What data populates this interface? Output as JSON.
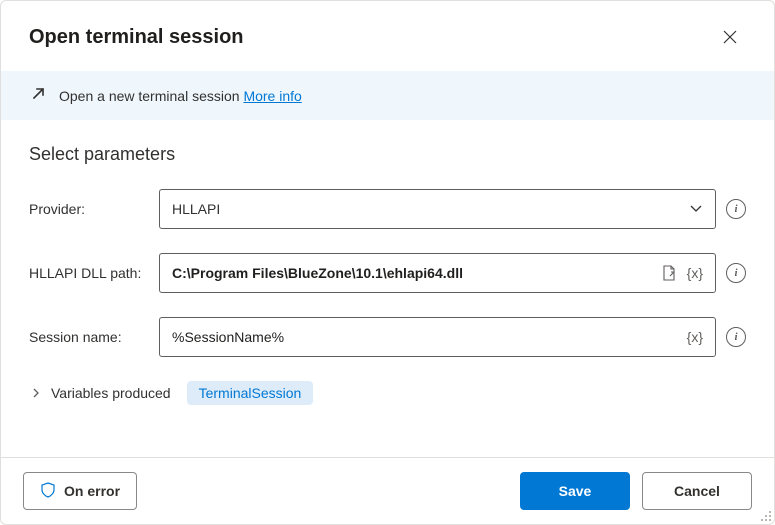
{
  "dialog": {
    "title": "Open terminal session"
  },
  "banner": {
    "text": "Open a new terminal session ",
    "link": "More info"
  },
  "section": {
    "heading": "Select parameters"
  },
  "form": {
    "provider": {
      "label": "Provider:",
      "value": "HLLAPI"
    },
    "dllpath": {
      "label": "HLLAPI DLL path:",
      "value": "C:\\Program Files\\BlueZone\\10.1\\ehlapi64.dll"
    },
    "session": {
      "label": "Session name:",
      "value": "%SessionName%"
    }
  },
  "variables": {
    "label": "Variables produced",
    "pill": "TerminalSession"
  },
  "footer": {
    "onerror": "On error",
    "save": "Save",
    "cancel": "Cancel"
  }
}
